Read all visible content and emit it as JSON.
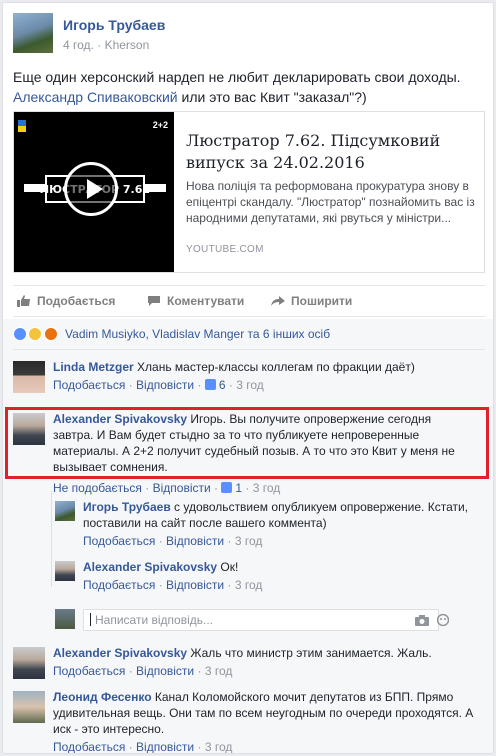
{
  "post": {
    "author": "Игорь Трубаев",
    "time": "4 год.",
    "location": "Kherson",
    "text_before": "Еще один херсонский нардеп не любит декларировать свои доходы.",
    "mention": "Александр Спиваковский",
    "text_after": " или это вас Квит \"заказал\"?)"
  },
  "preview": {
    "title": "Люстратор 7.62. Підсумковий випуск за 24.02.2016",
    "description": "Нова поліція та реформована прокуратура знову в епіцентрі скандалу. \"Люстратор\" познайомить вас із народними депутатами, які рвуться у міністри...",
    "domain": "YOUTUBE.COM",
    "thumb_channel": "2+2",
    "thumb_logo": "ЛЮСТРАТОР 7.62"
  },
  "actions": {
    "like": "Подобається",
    "comment": "Коментувати",
    "share": "Поширити"
  },
  "reactions": {
    "names": "Vadim Musiyko, Vladislav Manger та 6 інших осіб"
  },
  "comments": [
    {
      "name": "Linda Metzger",
      "text": "Хлань мастер-классы коллегам по фракции даёт)",
      "like": "Подобається",
      "reply": "Відповісти",
      "likes": "6",
      "time": "3 год"
    },
    {
      "name": "Alexander Spivakovsky",
      "text": "Игорь. Вы получите опровержение сегодня завтра. И Вам будет стыдно за то что публикуете непроверенные материалы. А 2+2 получит судебный позыв. А то что это Квит у меня не вызывает сомнения.",
      "like": "Не подобається",
      "reply": "Відповісти",
      "likes": "1",
      "time": "3 год"
    },
    {
      "name": "Alexander Spivakovsky",
      "text": "Жаль что министр этим занимается. Жаль.",
      "like": "Подобається",
      "reply": "Відповісти",
      "time": "3 год"
    },
    {
      "name": "Леонид Фесенко",
      "text": "Канал Коломойского мочит депутатов из БПП. Прямо удивительная вещь. Они там по всем неугодным по очереди проходятся. А иск - это интересно.",
      "like": "Подобається",
      "reply": "Відповісти",
      "time": "3 год"
    }
  ],
  "replies": [
    {
      "name": "Игорь Трубаев",
      "text": "с удовольствием опубликуем опровержение. Кстати, поставили на сайт после вашего коммента)",
      "like": "Подобається",
      "reply": "Відповісти",
      "time": "3 год"
    },
    {
      "name": "Alexander Spivakovsky",
      "text": "Ок!",
      "like": "Подобається",
      "reply": "Відповісти",
      "time": "3 год"
    }
  ],
  "reply_input": {
    "placeholder": "Написати відповідь..."
  },
  "separator": "·",
  "colors": {
    "link": "#365899",
    "highlight": "#e0212b",
    "meta": "#90949c"
  }
}
